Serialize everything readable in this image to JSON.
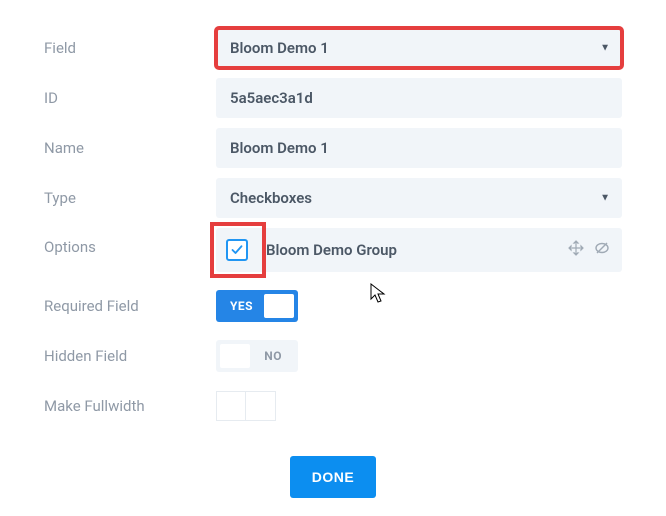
{
  "labels": {
    "field": "Field",
    "id": "ID",
    "name": "Name",
    "type": "Type",
    "options": "Options",
    "required": "Required Field",
    "hidden": "Hidden Field",
    "fullwidth": "Make Fullwidth"
  },
  "values": {
    "field_selected": "Bloom Demo 1",
    "id": "5a5aec3a1d",
    "name": "Bloom Demo 1",
    "type_selected": "Checkboxes",
    "option_label": "Bloom Demo Group"
  },
  "toggles": {
    "yes": "YES",
    "no": "NO"
  },
  "buttons": {
    "done": "DONE"
  }
}
